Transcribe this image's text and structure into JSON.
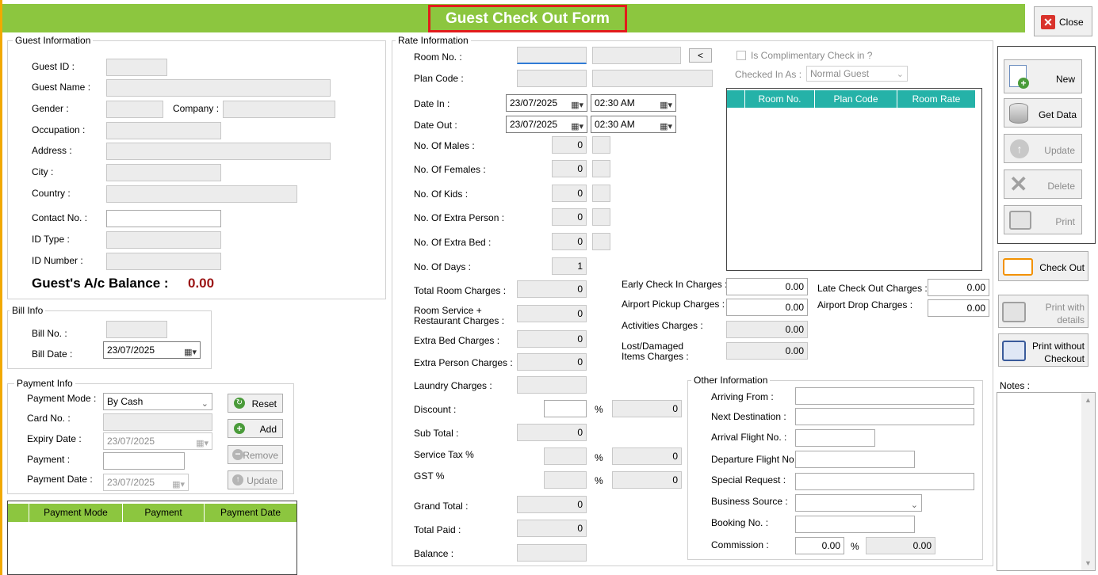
{
  "window": {
    "title": "Guest Check Out Form",
    "close_label": "Close"
  },
  "colors": {
    "title_bar": "#8cc63f",
    "title_border": "#e21b1b",
    "grid_header_teal": "#25b2a8",
    "grid_header_green": "#8cc63f",
    "balance_value": "#9b1515"
  },
  "guest_info": {
    "caption": "Guest Information",
    "guest_id_label": "Guest ID :",
    "guest_name_label": "Guest Name :",
    "gender_label": "Gender :",
    "company_label": "Company :",
    "occupation_label": "Occupation :",
    "address_label": "Address :",
    "city_label": "City :",
    "country_label": "Country :",
    "contact_label": "Contact No. :",
    "id_type_label": "ID Type :",
    "id_number_label": "ID Number :",
    "balance_label": "Guest's A/c Balance :",
    "balance_value": "0.00"
  },
  "bill_info": {
    "caption": "Bill Info",
    "bill_no_label": "Bill No. :",
    "bill_date_label": "Bill Date :",
    "bill_date_value": "23/07/2025"
  },
  "payment_info": {
    "caption": "Payment Info",
    "mode_label": "Payment Mode :",
    "mode_value": "By Cash",
    "card_label": "Card No. :",
    "expiry_label": "Expiry Date :",
    "expiry_value": "23/07/2025",
    "payment_label": "Payment :",
    "payment_date_label": "Payment Date :",
    "payment_date_value": "23/07/2025",
    "reset_label": "Reset",
    "add_label": "Add",
    "remove_label": "Remove",
    "update_label": "Update",
    "grid_columns": [
      "Payment Mode",
      "Payment",
      "Payment Date"
    ]
  },
  "rate_info": {
    "caption": "Rate Information",
    "room_no_label": "Room No. :",
    "back_label": "<",
    "plan_code_label": "Plan Code :",
    "date_in_label": "Date In :",
    "date_in_value": "23/07/2025",
    "time_in_value": "02:30 AM",
    "date_out_label": "Date Out :",
    "date_out_value": "23/07/2025",
    "time_out_value": "02:30 AM",
    "males_label": "No. Of Males :",
    "males_value": "0",
    "females_label": "No. Of Females :",
    "females_value": "0",
    "kids_label": "No. Of Kids :",
    "kids_value": "0",
    "extra_person_label": "No. Of Extra Person :",
    "extra_person_value": "0",
    "extra_bed_label": "No. Of Extra Bed :",
    "extra_bed_value": "0",
    "days_label": "No. Of Days :",
    "days_value": "1",
    "complimentary_label": "Is Complimentary Check in ?",
    "checked_in_as_label": "Checked In As :",
    "checked_in_as_value": "Normal Guest",
    "room_grid_columns": [
      "Room No.",
      "Plan Code",
      "Room Rate"
    ],
    "total_room_label": "Total Room Charges :",
    "total_room_value": "0",
    "room_service_label_1": "Room Service +",
    "room_service_label_2": "Restaurant Charges :",
    "room_service_value": "0",
    "extra_bed_charges_label": "Extra Bed Charges :",
    "extra_bed_charges_value": "0",
    "extra_person_charges_label": "Extra Person Charges :",
    "extra_person_charges_value": "0",
    "laundry_label": "Laundry Charges :",
    "discount_label": "Discount :",
    "discount_pct": "%",
    "discount_value": "0",
    "sub_total_label": "Sub Total :",
    "sub_total_value": "0",
    "service_tax_label": "Service Tax %",
    "service_tax_pct": "%",
    "service_tax_value": "0",
    "gst_label": "GST %",
    "gst_pct": "%",
    "gst_value": "0",
    "grand_total_label": "Grand Total :",
    "grand_total_value": "0",
    "total_paid_label": "Total Paid :",
    "total_paid_value": "0",
    "balance_label": "Balance :",
    "early_checkin_label": "Early Check In Charges :",
    "early_checkin_value": "0.00",
    "late_checkout_label": "Late Check Out Charges :",
    "late_checkout_value": "0.00",
    "airport_pickup_label": "Airport Pickup Charges :",
    "airport_pickup_value": "0.00",
    "airport_drop_label": "Airport Drop Charges :",
    "airport_drop_value": "0.00",
    "activities_label": "Activities Charges :",
    "activities_value": "0.00",
    "lost_label_1": "Lost/Damaged",
    "lost_label_2": "Items Charges :",
    "lost_value": "0.00"
  },
  "other_info": {
    "caption": "Other Information",
    "arriving_label": "Arriving From :",
    "next_dest_label": "Next Destination :",
    "arrival_flight_label": "Arrival Flight No. :",
    "departure_flight_label": "Departure Flight No. :",
    "special_request_label": "Special Request :",
    "business_source_label": "Business Source :",
    "booking_label": "Booking No. :",
    "commission_label": "Commission :",
    "commission_value": "0.00",
    "commission_pct": "%",
    "commission_amount": "0.00"
  },
  "toolbar": {
    "new_label": "New",
    "get_data_label": "Get Data",
    "update_label": "Update",
    "delete_label": "Delete",
    "print_label": "Print",
    "check_out_label": "Check Out",
    "print_details_1": "Print with",
    "print_details_2": "details",
    "print_without_1": "Print without",
    "print_without_2": "Checkout",
    "notes_label": "Notes :"
  }
}
